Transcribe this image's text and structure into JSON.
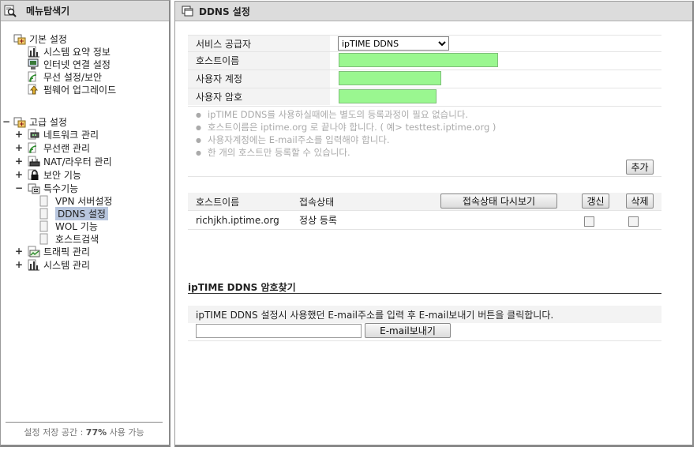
{
  "left": {
    "header_title": "메뉴탐색기",
    "tree": {
      "basic": {
        "label": "기본 설정",
        "items": [
          "시스템 요약 정보",
          "인터넷 연결 설정",
          "무선 설정/보안",
          "펌웨어 업그레이드"
        ]
      },
      "advanced": {
        "toggle": "−",
        "label": "고급 설정",
        "items": [
          {
            "toggle": "+",
            "label": "네트워크 관리"
          },
          {
            "toggle": "+",
            "label": "무선랜 관리"
          },
          {
            "toggle": "+",
            "label": "NAT/라우터 관리"
          },
          {
            "toggle": "+",
            "label": "보안 기능"
          },
          {
            "toggle": "−",
            "label": "특수기능"
          }
        ],
        "special_items": [
          "VPN 서버설정",
          "DDNS 설정",
          "WOL 기능",
          "호스트검색"
        ],
        "bottom_items": [
          {
            "toggle": "+",
            "label": "트래픽 관리"
          },
          {
            "toggle": "+",
            "label": "시스템 관리"
          }
        ]
      }
    },
    "footer": {
      "prefix": "설정 저장 공간 : ",
      "value": "77%",
      "suffix": " 사용 가능"
    }
  },
  "right": {
    "header_title": "DDNS 설정",
    "form": {
      "provider_label": "서비스 공급자",
      "provider_value": "ipTIME DDNS",
      "hostname_label": "호스트이름",
      "hostname_value": "",
      "account_label": "사용자 계정",
      "account_value": "",
      "password_label": "사용자 암호",
      "password_value": ""
    },
    "notes": [
      "ipTIME DDNS를 사용하실때에는 별도의 등록과정이 필요 없습니다.",
      "호스트이름은 iptime.org 로 끝나야 합니다. ( 예> testtest.iptime.org )",
      "사용자계정에는 E-mail주소를 입력해야 합니다.",
      "한 개의 호스트만 등록할 수 있습니다."
    ],
    "add_button": "추가",
    "table": {
      "col_host": "호스트이름",
      "col_status": "접속상태",
      "refresh_button": "접속상태 다시보기",
      "renew_button": "갱신",
      "delete_button": "삭제",
      "rows": [
        {
          "host": "richjkh.iptime.org",
          "status": "정상 등록"
        }
      ]
    },
    "recover": {
      "title": "ipTIME DDNS 암호찾기",
      "description": "ipTIME DDNS 설정시 사용했던 E-mail주소를 입력 후 E-mail보내기 버튼을 클릭합니다.",
      "email_value": "",
      "send_button": "E-mail보내기"
    }
  }
}
